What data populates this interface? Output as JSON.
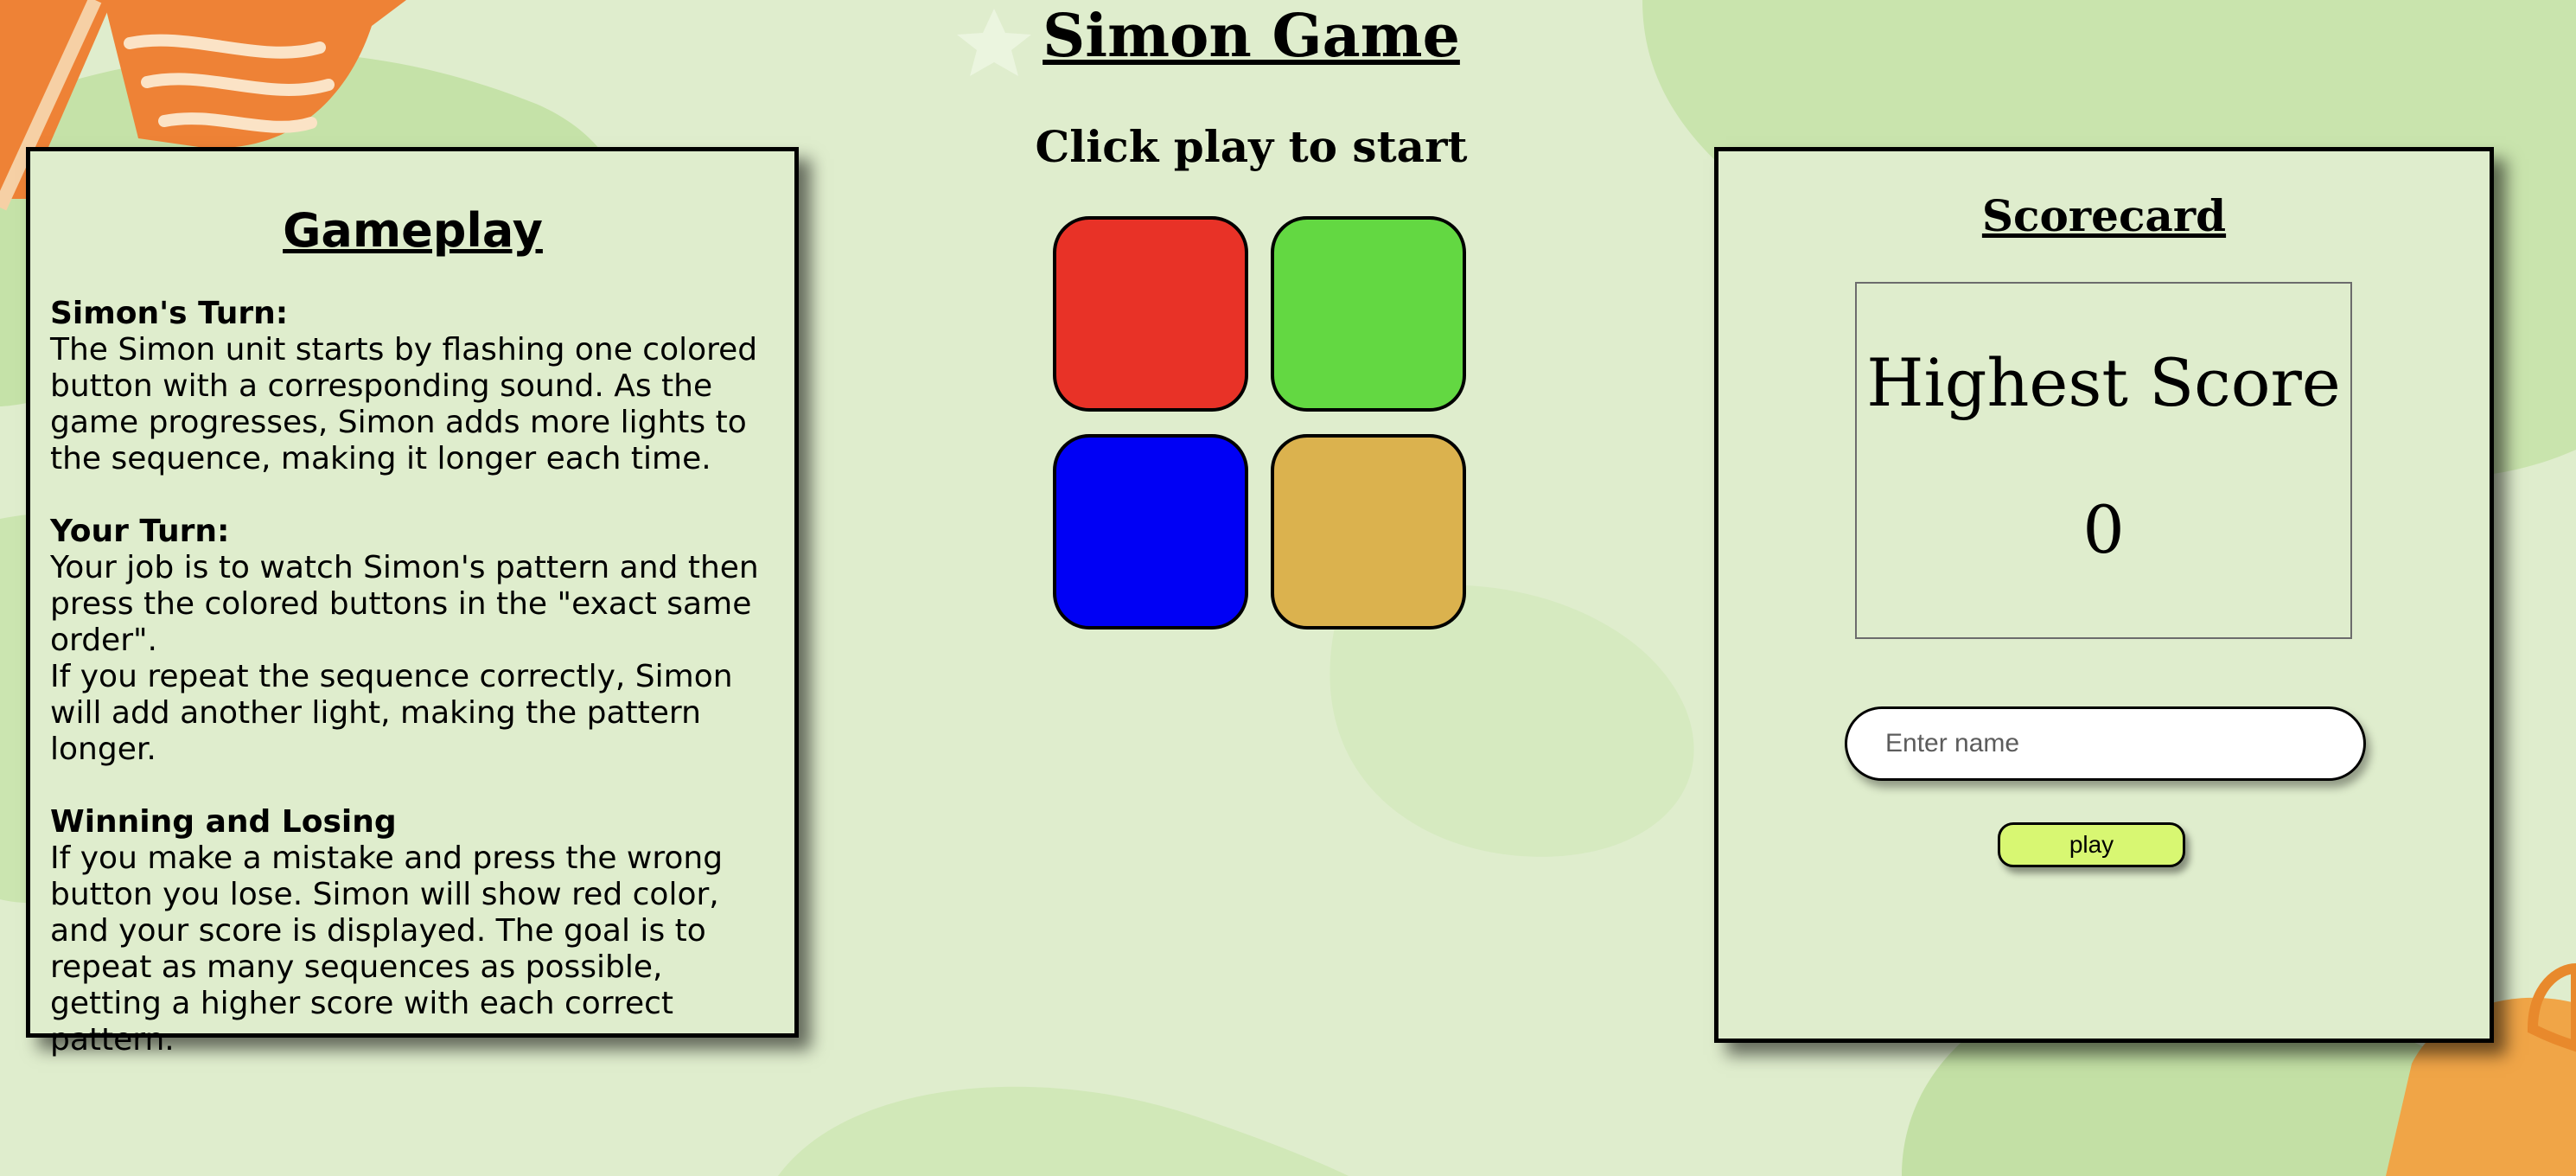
{
  "header": {
    "title": "Simon Game",
    "status": "Click play to start"
  },
  "gameplay": {
    "title": "Gameplay",
    "sections": [
      {
        "heading": "Simon's Turn:",
        "body": "The Simon unit starts by flashing one colored button with a corresponding sound. As the game progresses, Simon adds more lights to the sequence, making it longer each time."
      },
      {
        "heading": "Your Turn:",
        "body": "Your job is to watch Simon's pattern and then press the colored buttons in the \"exact same order\".\nIf you repeat the sequence correctly, Simon will add another light, making the pattern longer."
      },
      {
        "heading": "Winning and Losing",
        "body": "If you make a mistake and press the wrong button you lose. Simon will show red color, and your score is displayed. The goal is to repeat as many sequences as possible, getting a higher score with each correct pattern."
      }
    ]
  },
  "pads": [
    {
      "name": "red",
      "color": "#e83227"
    },
    {
      "name": "green",
      "color": "#63d842"
    },
    {
      "name": "blue",
      "color": "#0000f5"
    },
    {
      "name": "yellow",
      "color": "#dbb24e"
    }
  ],
  "scorecard": {
    "title": "Scorecard",
    "highest_score_label": "Highest Score",
    "highest_score_value": "0",
    "name_input": {
      "placeholder": "Enter name",
      "value": ""
    },
    "play_label": "play"
  },
  "colors": {
    "background": "#dfedcd",
    "play_button": "#d8f772",
    "flag": "#ee8236"
  }
}
